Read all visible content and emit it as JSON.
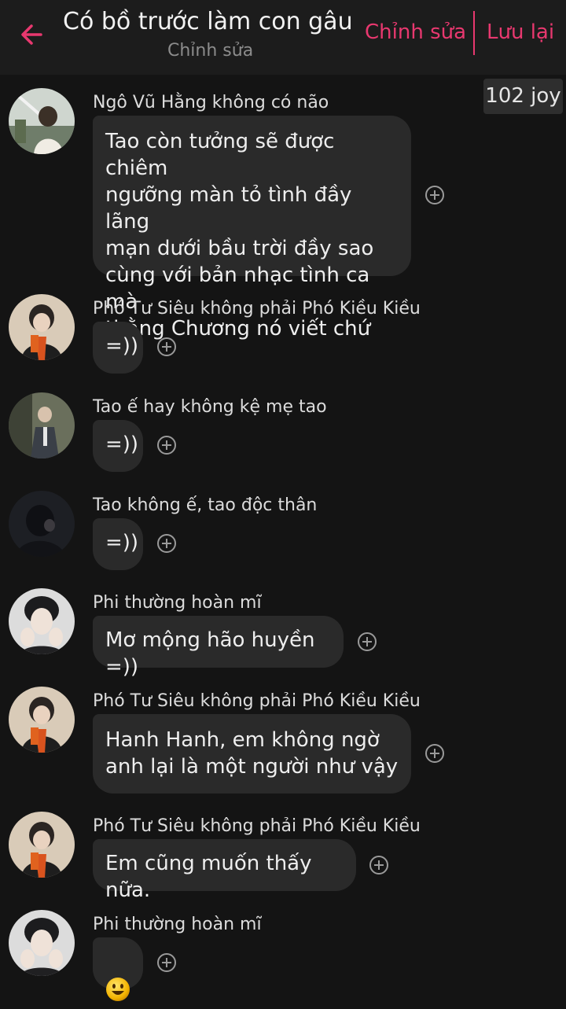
{
  "header": {
    "title": "Có bồ trước làm con gâu ...",
    "subtitle": "Chỉnh sửa",
    "edit_label": "Chỉnh sửa",
    "save_label": "Lưu lại",
    "accent_color": "#e8386f"
  },
  "joy_badge": "102 joy",
  "messages": [
    {
      "sender": "Ngô Vũ Hằng không có não",
      "text": "Tao còn tưởng sẽ được chiêm\nngưỡng màn tỏ tình đầy lãng\nmạn dưới bầu trời đầy sao\ncùng với bản nhạc tình ca mà\nthằng Chương nó viết chứ =))"
    },
    {
      "sender": "Phó Tư Siêu không phải Phó Kiều Kiều",
      "text": "=))"
    },
    {
      "sender": "Tao ế hay không kệ mẹ tao",
      "text": "=))"
    },
    {
      "sender": "Tao không ế, tao độc thân",
      "text": "=))"
    },
    {
      "sender": "Phi thường hoàn mĩ",
      "text": "Mơ mộng hão huyền =))"
    },
    {
      "sender": "Phó Tư Siêu không phải Phó Kiều Kiều",
      "text": "Hanh Hanh, em không ngờ\nanh lại là một người như vậy"
    },
    {
      "sender": "Phó Tư Siêu không phải Phó Kiều Kiều",
      "text": "Em cũng muốn thấy nữa."
    },
    {
      "sender": "Phi thường hoàn mĩ",
      "emoji": "smiling-face"
    }
  ]
}
